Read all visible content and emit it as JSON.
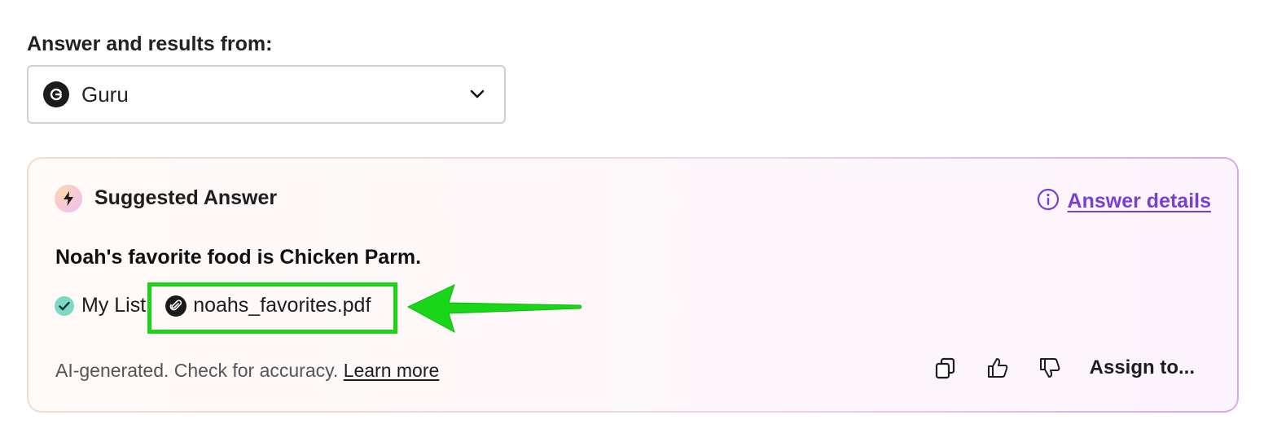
{
  "source": {
    "label": "Answer and results from:",
    "selected": "Guru",
    "logo_icon": "guru-logo-icon"
  },
  "answer_card": {
    "title": "Suggested Answer",
    "details_link": "Answer details",
    "answer": "Noah's favorite food is Chicken Parm.",
    "sources": {
      "list_label": "My List",
      "file_name": "noahs_favorites.pdf"
    },
    "footnote": "AI-generated. Check for accuracy.",
    "learn_more": "Learn more",
    "actions": {
      "copy_icon": "copy-icon",
      "thumbs_up_icon": "thumbs-up-icon",
      "thumbs_down_icon": "thumbs-down-icon",
      "assign_label": "Assign to..."
    }
  },
  "colors": {
    "accent_purple": "#7a3fd1",
    "highlight_green": "#19d619",
    "check_teal": "#7fd8c5"
  }
}
